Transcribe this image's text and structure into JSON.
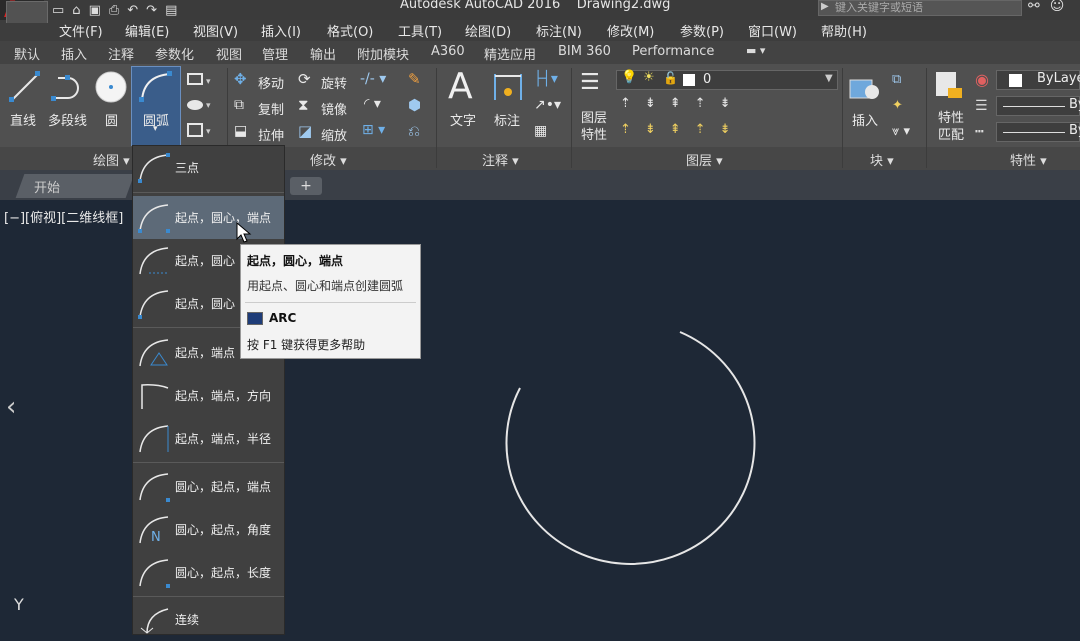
{
  "app": {
    "window_title": "Autodesk AutoCAD 2016    Drawing2.dwg",
    "search_placeholder": "键入关键字或短语"
  },
  "menubar": [
    "文件(F)",
    "编辑(E)",
    "视图(V)",
    "插入(I)",
    "格式(O)",
    "工具(T)",
    "绘图(D)",
    "标注(N)",
    "修改(M)",
    "参数(P)",
    "窗口(W)",
    "帮助(H)"
  ],
  "ribbon_tabs": [
    "默认",
    "插入",
    "注释",
    "参数化",
    "视图",
    "管理",
    "输出",
    "附加模块",
    "A360",
    "精选应用",
    "BIM 360",
    "Performance"
  ],
  "active_tab": "默认",
  "draw_panel": {
    "line": "直线",
    "polyline": "多段线",
    "circle": "圆",
    "arc": "圆弧",
    "panel_label": "绘图 ▾"
  },
  "modify_panel": {
    "move": "移动",
    "rotate": "旋转",
    "copy": "复制",
    "mirror": "镜像",
    "stretch": "拉伸",
    "scale": "缩放",
    "panel_label": "修改 ▾"
  },
  "annotation_panel": {
    "text": "文字",
    "dimension": "标注",
    "panel_label": "注释 ▾"
  },
  "layers_panel": {
    "layer_properties": "图层\n特性",
    "current_layer": "0",
    "panel_label": "图层 ▾"
  },
  "block_panel": {
    "insert": "插入",
    "panel_label": "块 ▾"
  },
  "properties_panel": {
    "match_properties": "特性\n匹配",
    "bylayer": "ByLaye",
    "by2": "By",
    "by3": "By",
    "panel_label": "特性 ▾"
  },
  "doc_tabs": {
    "start": "开始",
    "plus": "+"
  },
  "viewport_label": "[−][俯视][二维线框]",
  "ucs_y": "Y",
  "arc_menu": [
    {
      "label": "三点"
    },
    {
      "label": "起点，圆心，端点"
    },
    {
      "label": "起点，圆心"
    },
    {
      "label": "起点，圆心"
    },
    {
      "label": "起点，端点"
    },
    {
      "label": "起点，端点，方向"
    },
    {
      "label": "起点，端点，半径"
    },
    {
      "label": "圆心，起点，端点"
    },
    {
      "label": "圆心，起点，角度"
    },
    {
      "label": "圆心，起点，长度"
    },
    {
      "label": "连续"
    }
  ],
  "tooltip": {
    "title": "起点，圆心，端点",
    "description": "用起点、圆心和端点创建圆弧",
    "command": "ARC",
    "help": "按 F1 键获得更多帮助"
  },
  "colors": {
    "canvas": "#1e2836",
    "ribbon": "#505050",
    "accent_blue": "#3a8ad0"
  }
}
